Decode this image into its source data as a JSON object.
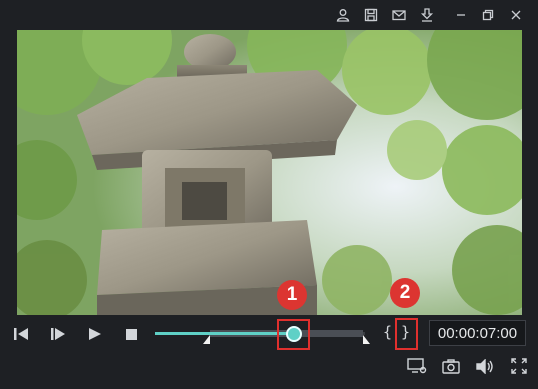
{
  "titlebar": {
    "icons": [
      "account-icon",
      "save-icon",
      "mail-icon",
      "download-icon",
      "minimize-icon",
      "restore-icon",
      "close-icon"
    ]
  },
  "playback": {
    "progress_fraction": 0.66,
    "in_point_fraction": 0.26,
    "out_point_fraction": 0.99,
    "timecode": "00:00:07:00",
    "in_brace": "{",
    "out_brace": "}"
  },
  "annotations": {
    "badge_1": "1",
    "badge_2": "2",
    "accent_color": "#dc3531"
  },
  "colors": {
    "played": "#5fd0c6",
    "background": "#1e2024"
  }
}
